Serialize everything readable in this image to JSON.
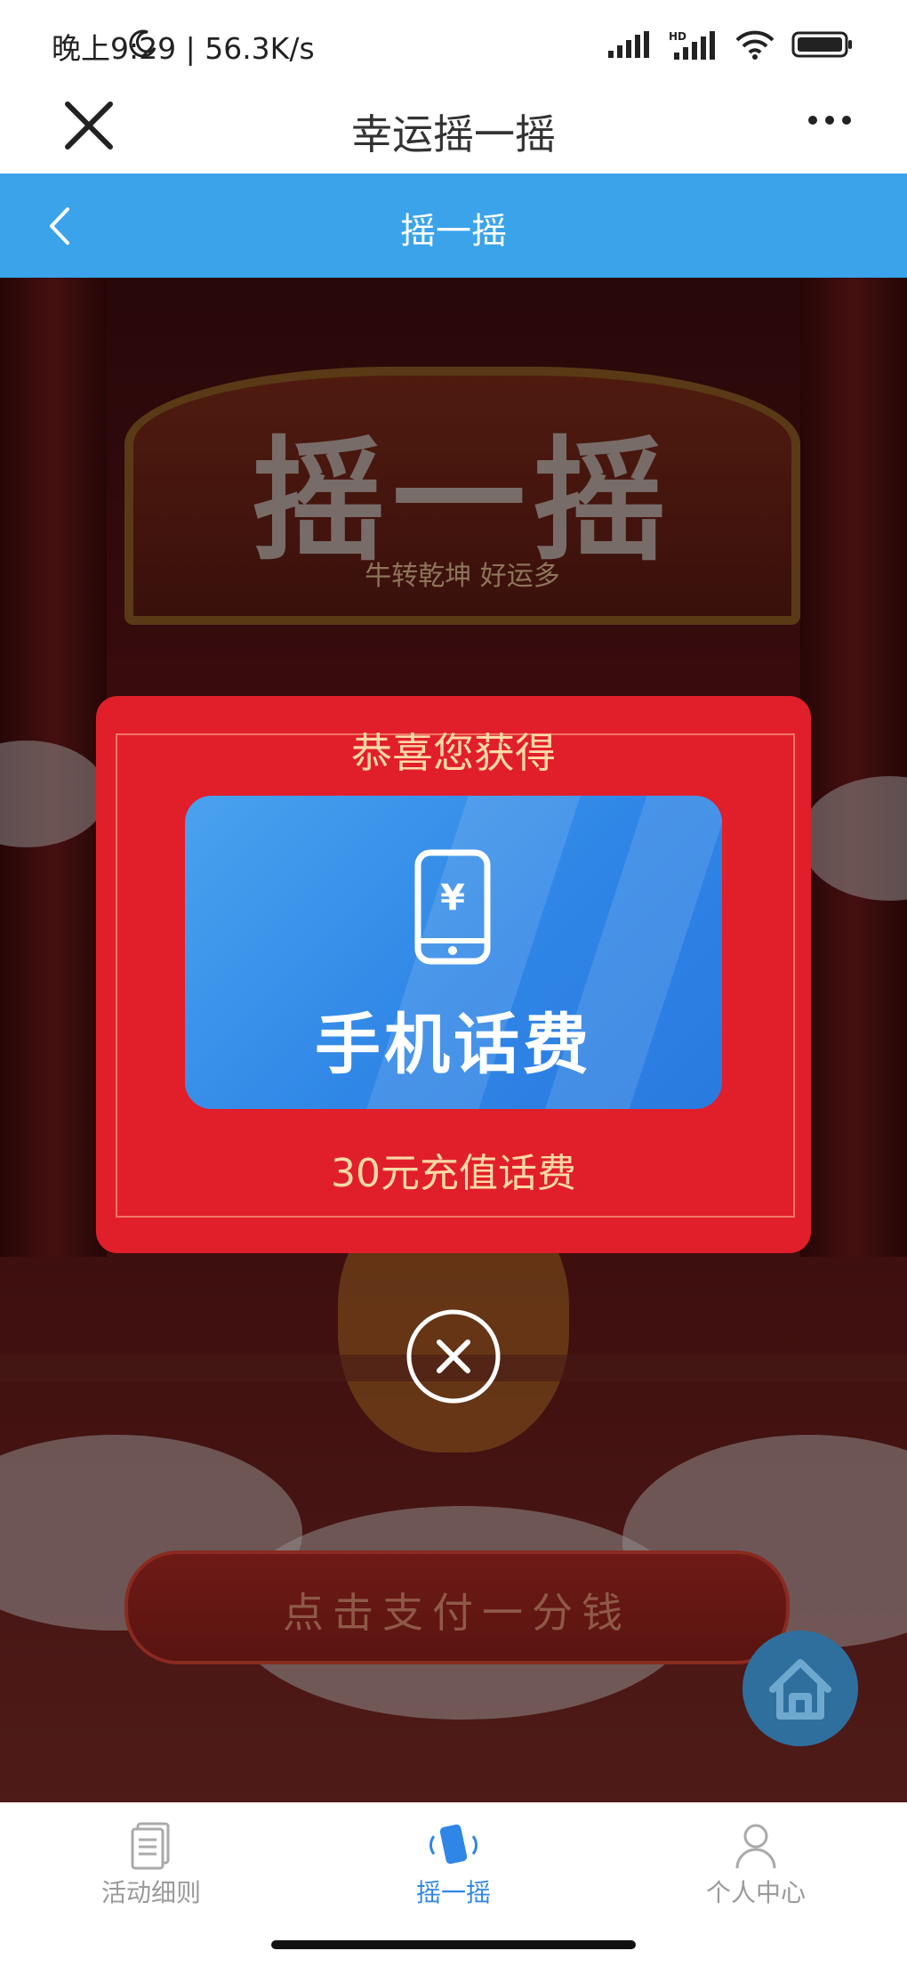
{
  "status_bar": {
    "time": "晚上9:29 | 56.3K/s"
  },
  "top_nav": {
    "title": "幸运摇一摇"
  },
  "header": {
    "title": "摇一摇"
  },
  "game": {
    "banner_title": "摇一摇",
    "banner_subtitle": "牛转乾坤 好运多",
    "pay_button": "点击支付一分钱"
  },
  "modal": {
    "heading": "恭喜您获得",
    "prize_name": "手机话费",
    "prize_desc": "30元充值话费"
  },
  "tabs": [
    {
      "label": "活动细则",
      "icon": "document-icon",
      "active": false
    },
    {
      "label": "摇一摇",
      "icon": "shake-phone-icon",
      "active": true
    },
    {
      "label": "个人中心",
      "icon": "person-icon",
      "active": false
    }
  ],
  "colors": {
    "accent": "#3aa3ea",
    "modal_red": "#e11f2b",
    "tab_active": "#2f86e6",
    "tab_inactive": "#9a9a9a"
  }
}
